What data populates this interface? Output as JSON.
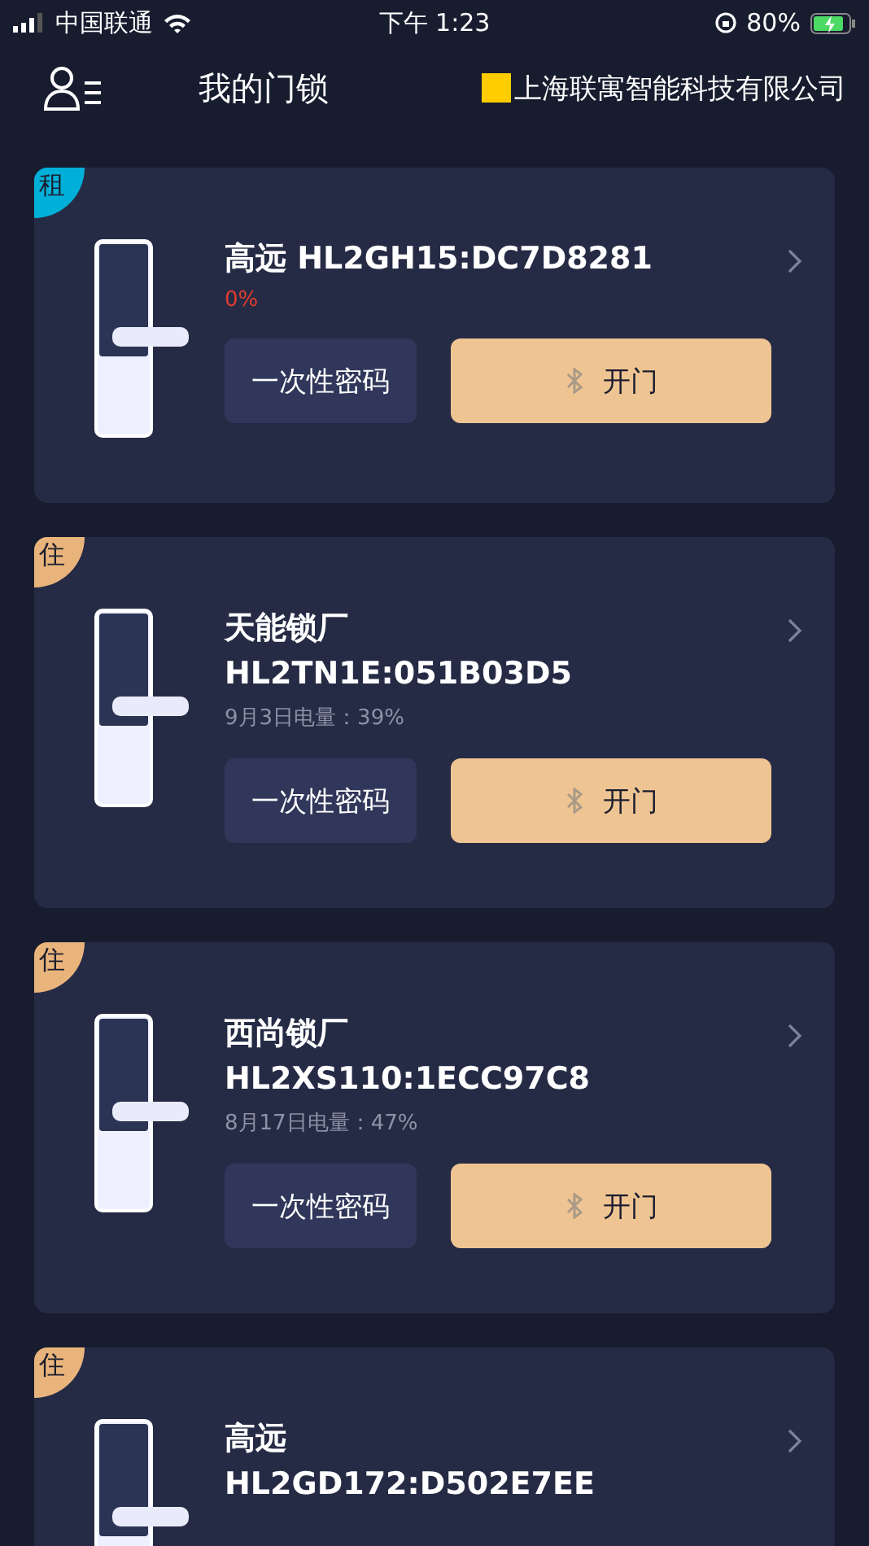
{
  "status_bar": {
    "carrier": "中国联通",
    "time": "下午 1:23",
    "battery": "80%"
  },
  "header": {
    "title": "我的门锁",
    "company": "上海联寓智能科技有限公司"
  },
  "locks": [
    {
      "badge": {
        "label": "租",
        "color": "#00b0d8"
      },
      "title_lines": [
        "高远 HL2GH15:DC7D8281"
      ],
      "battery_text": "0%",
      "low_battery": true,
      "buttons": [
        "一次性密码",
        "开门"
      ]
    },
    {
      "badge": {
        "label": "住",
        "color": "#e9b47c"
      },
      "title_lines": [
        "天能锁厂",
        "HL2TN1E:051B03D5"
      ],
      "battery_text": "9月3日电量：39%",
      "low_battery": false,
      "buttons": [
        "一次性密码",
        "开门"
      ]
    },
    {
      "badge": {
        "label": "住",
        "color": "#e9b47c"
      },
      "title_lines": [
        "西尚锁厂",
        "HL2XS110:1ECC97C8"
      ],
      "battery_text": "8月17日电量：47%",
      "low_battery": false,
      "buttons": [
        "一次性密码",
        "开门"
      ]
    },
    {
      "badge": {
        "label": "住",
        "color": "#e9b47c"
      },
      "title_lines": [
        "高远",
        "HL2GD172:D502E7EE"
      ]
    }
  ]
}
